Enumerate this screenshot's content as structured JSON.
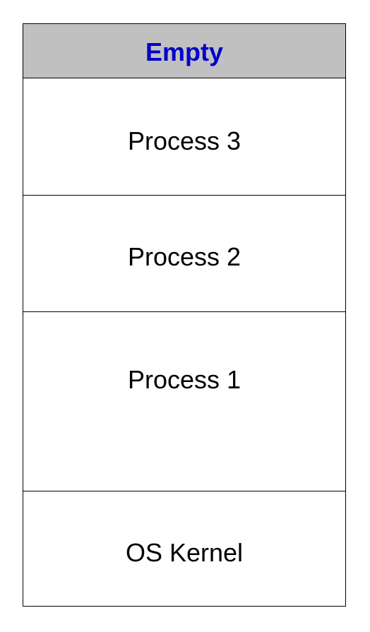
{
  "memory_layout": {
    "blocks": [
      {
        "label": "Empty",
        "fill": "#c0c0c0",
        "text_color": "#0000cc"
      },
      {
        "label": "Process 3",
        "fill": "#ffffff",
        "text_color": "#000000"
      },
      {
        "label": "Process 2",
        "fill": "#ffffff",
        "text_color": "#000000"
      },
      {
        "label": "Process 1",
        "fill": "#ffffff",
        "text_color": "#000000"
      },
      {
        "label": "OS Kernel",
        "fill": "#ffffff",
        "text_color": "#000000"
      }
    ]
  }
}
